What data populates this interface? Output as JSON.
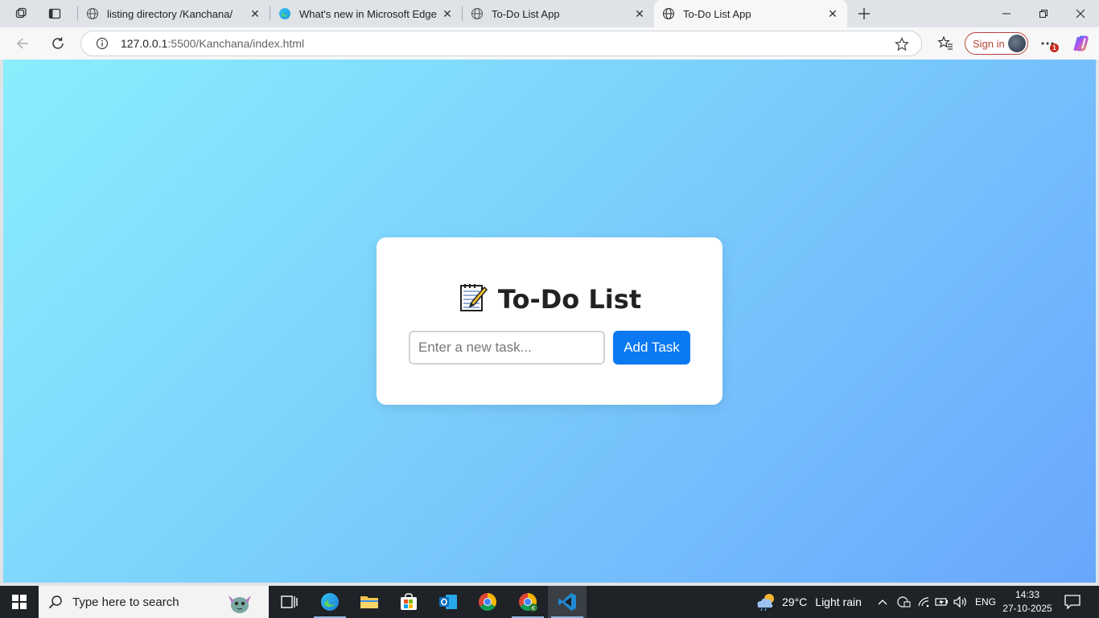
{
  "browser": {
    "tabs": [
      {
        "title": "listing directory /Kanchana/",
        "active": false
      },
      {
        "title": "What's new in Microsoft Edge",
        "active": false
      },
      {
        "title": "To-Do List App",
        "active": false
      },
      {
        "title": "To-Do List App",
        "active": true
      }
    ],
    "url_host": "127.0.0.1",
    "url_path": ":5500/Kanchana/index.html",
    "sign_in_label": "Sign in",
    "notification_count": "1"
  },
  "page": {
    "heading": "To-Do List",
    "heading_icon": "📝",
    "input_placeholder": "Enter a new task...",
    "input_value": "",
    "add_button_label": "Add Task",
    "background_colors": [
      "#8aeefc",
      "#68a6fc"
    ],
    "button_color": "#0a79f2"
  },
  "taskbar": {
    "search_placeholder": "Type here to search",
    "weather_temp": "29°C",
    "weather_desc": "Light rain",
    "language": "ENG",
    "time": "14:33",
    "date": "27-10-2025"
  }
}
